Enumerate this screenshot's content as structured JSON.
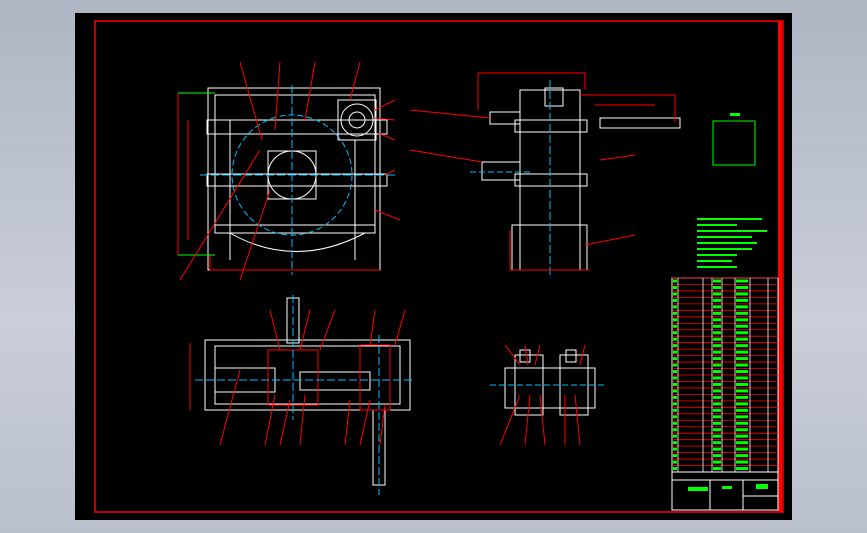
{
  "colors": {
    "background": "#000000",
    "border": "#ff0000",
    "outline": "#ffffff",
    "annotation": "#00ff00",
    "centerline": "#00bfff",
    "leader": "#ff0000"
  },
  "drawing": {
    "views": [
      "front-view",
      "side-view",
      "top-section-view",
      "detail-view"
    ],
    "parts_list_rows": 30
  }
}
